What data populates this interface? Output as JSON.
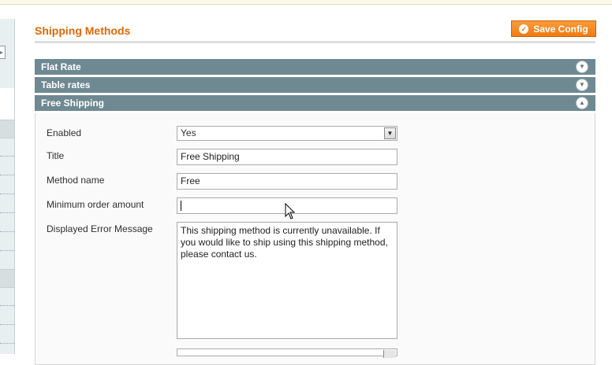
{
  "page": {
    "title": "Shipping Methods",
    "save_label": "Save Config",
    "accent_color": "#e26703",
    "button_color": "#f07b10",
    "header_color": "#6f8992"
  },
  "sections": [
    {
      "label": "Flat Rate",
      "state": "collapsed",
      "icon": "chevron-down-icon"
    },
    {
      "label": "Table rates",
      "state": "collapsed",
      "icon": "chevron-down-icon"
    },
    {
      "label": "Free Shipping",
      "state": "expanded",
      "icon": "chevron-up-icon"
    }
  ],
  "free_shipping": {
    "enabled_label": "Enabled",
    "enabled_value": "Yes",
    "title_label": "Title",
    "title_value": "Free Shipping",
    "method_name_label": "Method name",
    "method_name_value": "Free",
    "min_order_label": "Minimum order amount",
    "min_order_value": "",
    "error_message_label": "Displayed Error Message",
    "error_message_value": "This shipping method is currently unavailable. If you would like to ship using this shipping method, please contact us."
  }
}
